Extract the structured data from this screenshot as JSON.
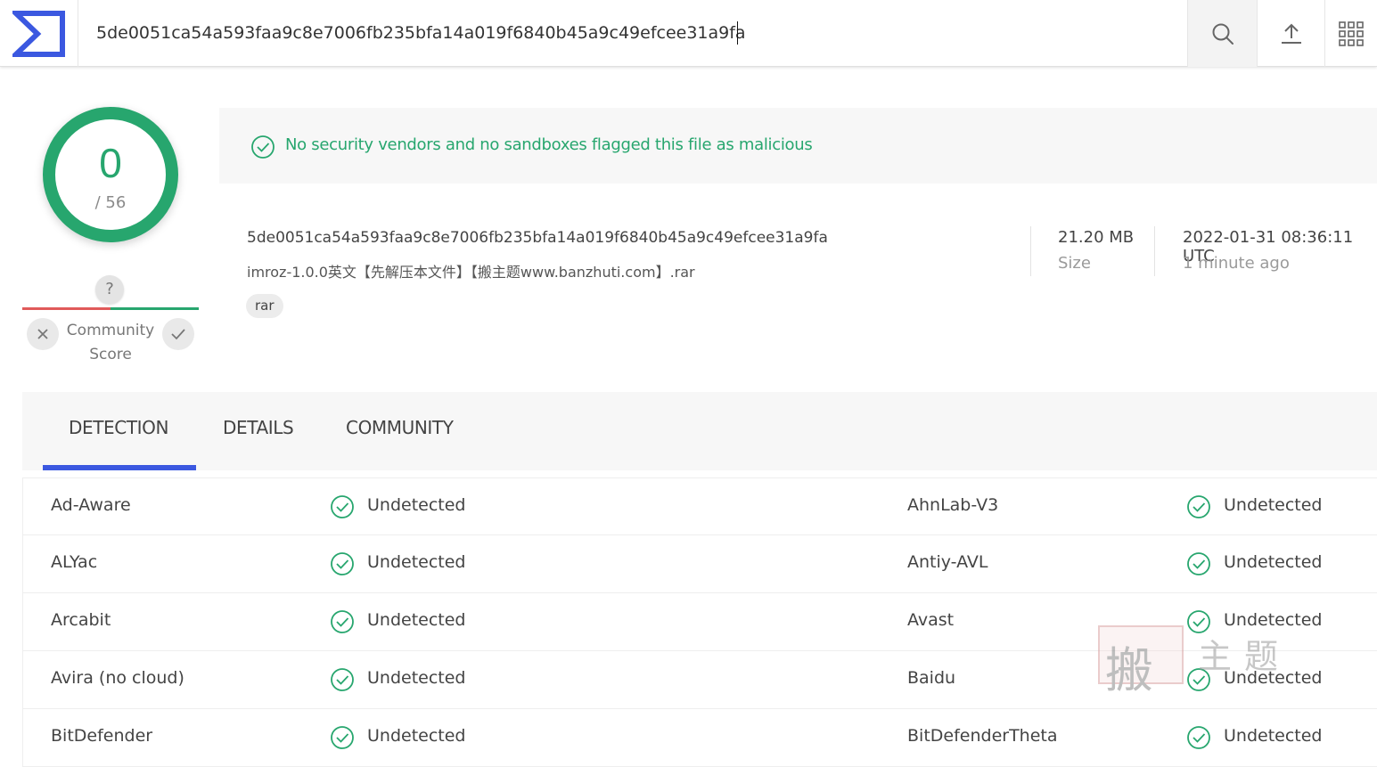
{
  "search": {
    "value": "5de0051ca54a593faa9c8e7006fb235bfa14a019f6840b45a9c49efcee31a9fa"
  },
  "score": {
    "detections": "0",
    "total": "/ 56"
  },
  "community": {
    "question": "?",
    "label_line1": "Community",
    "label_line2": "Score"
  },
  "banner": {
    "text": "No security vendors and no sandboxes flagged this file as malicious"
  },
  "file": {
    "hash": "5de0051ca54a593faa9c8e7006fb235bfa14a019f6840b45a9c49efcee31a9fa",
    "name": "imroz-1.0.0英文【先解压本文件】【搬主题www.banzhuti.com】.rar",
    "tag": "rar",
    "size_value": "21.20 MB",
    "size_label": "Size",
    "date_value": "2022-01-31 08:36:11 UTC",
    "date_label": "1 minute ago"
  },
  "tabs": [
    {
      "label": "DETECTION"
    },
    {
      "label": "DETAILS"
    },
    {
      "label": "COMMUNITY"
    }
  ],
  "results": [
    {
      "left_vendor": "Ad-Aware",
      "left_status": "Undetected",
      "right_vendor": "AhnLab-V3",
      "right_status": "Undetected"
    },
    {
      "left_vendor": "ALYac",
      "left_status": "Undetected",
      "right_vendor": "Antiy-AVL",
      "right_status": "Undetected"
    },
    {
      "left_vendor": "Arcabit",
      "left_status": "Undetected",
      "right_vendor": "Avast",
      "right_status": "Undetected"
    },
    {
      "left_vendor": "Avira (no cloud)",
      "left_status": "Undetected",
      "right_vendor": "Baidu",
      "right_status": "Undetected"
    },
    {
      "left_vendor": "BitDefender",
      "left_status": "Undetected",
      "right_vendor": "BitDefenderTheta",
      "right_status": "Undetected"
    }
  ],
  "watermark": {
    "glyph": "搬",
    "text": "主题"
  },
  "colors": {
    "accent_green": "#27a66e",
    "accent_blue": "#3b58e0",
    "negative_red": "#e05a5a"
  }
}
